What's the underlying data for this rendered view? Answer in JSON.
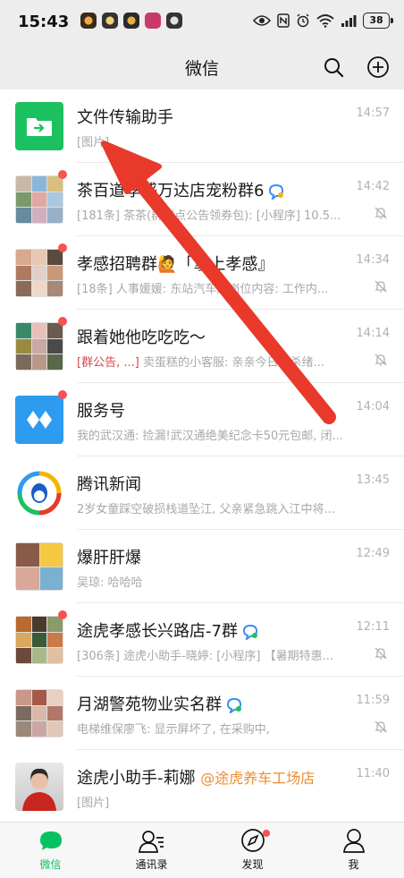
{
  "status_bar": {
    "time": "15:43",
    "battery": "38"
  },
  "header": {
    "title": "微信"
  },
  "chats": [
    {
      "name": "文件传输助手",
      "time": "14:57",
      "preview": "[图片]",
      "muted": false,
      "unread_dot": false
    },
    {
      "name": "茶百道孝感万达店宠粉群6",
      "time": "14:42",
      "preview": "[181条] 茶茶(群群点公告领券包): [小程序] 10.5...",
      "muted": true,
      "unread_dot": true
    },
    {
      "name": "孝感招聘群🙋「掌上孝感』",
      "time": "14:34",
      "preview": "[18条] 人事媛媛: 东站汽车厂岗位内容: 工作内...",
      "muted": true,
      "unread_dot": true
    },
    {
      "name": "跟着她他吃吃吃～",
      "time": "14:14",
      "preview_red": "[群公告, ...]",
      "preview": " 卖蛋糕的小客服: 亲亲今日秒杀绪...",
      "muted": true,
      "unread_dot": true
    },
    {
      "name": "服务号",
      "time": "14:04",
      "preview": "我的武汉通: 捡漏!武汉通绝美纪念卡50元包邮, 闭...",
      "muted": false,
      "unread_dot": true
    },
    {
      "name": "腾讯新闻",
      "time": "13:45",
      "preview": "2岁女童踩空破损栈道坠江, 父亲紧急跳入江中将...",
      "muted": false,
      "unread_dot": false
    },
    {
      "name": "爆肝肝爆",
      "time": "12:49",
      "preview": "吴琼: 哈哈哈",
      "muted": false,
      "unread_dot": false
    },
    {
      "name": "途虎孝感长兴路店-7群",
      "time": "12:11",
      "preview": "[306条] 途虎小助手-晓婷: [小程序] 【暑期特惠...",
      "muted": true,
      "unread_dot": true
    },
    {
      "name": "月湖警苑物业实名群",
      "time": "11:59",
      "preview": "电梯维保廖飞: 显示屏坏了, 在采购中,",
      "muted": true,
      "unread_dot": false
    },
    {
      "name": "途虎小助手-莉娜",
      "suffix": "@途虎养车工场店",
      "time": "11:40",
      "preview": "[图片]",
      "muted": false,
      "unread_dot": false
    }
  ],
  "tabs": [
    {
      "label": "微信",
      "active": true
    },
    {
      "label": "通讯录",
      "active": false
    },
    {
      "label": "发现",
      "active": false,
      "dot": true
    },
    {
      "label": "我",
      "active": false
    }
  ],
  "colors": {
    "accent": "#07c160",
    "unread": "#fa5151",
    "arrow": "#e8392b"
  }
}
